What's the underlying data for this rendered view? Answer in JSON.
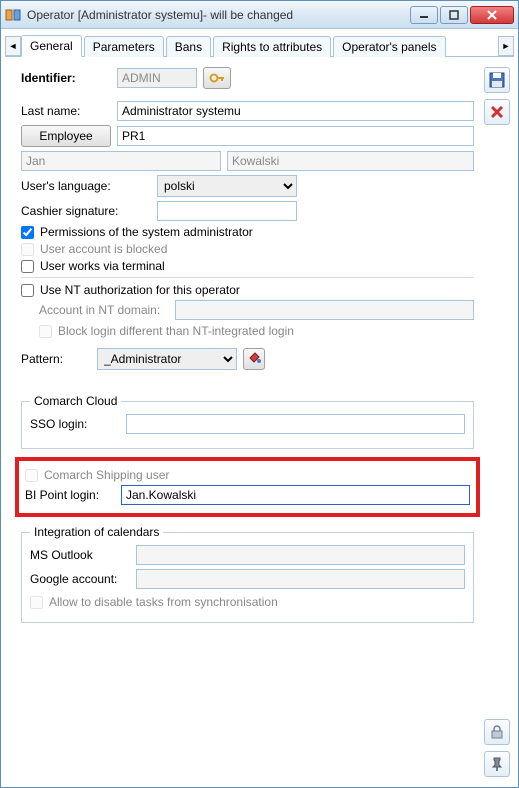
{
  "window": {
    "title": "Operator [Administrator systemu]- will be changed"
  },
  "tabs": {
    "general": "General",
    "parameters": "Parameters",
    "bans": "Bans",
    "rights": "Rights to attributes",
    "panels": "Operator's panels"
  },
  "identifier": {
    "label": "Identifier:",
    "value": "ADMIN"
  },
  "lastname": {
    "label": "Last name:",
    "value": "Administrator systemu"
  },
  "employee": {
    "button": "Employee",
    "value": "PR1"
  },
  "first_name": "Jan",
  "surname": "Kowalski",
  "language": {
    "label": "User's language:",
    "value": "polski"
  },
  "cashier": {
    "label": "Cashier signature:",
    "value": ""
  },
  "checkboxes": {
    "perms_admin": "Permissions of the system administrator",
    "account_blocked": "User account is blocked",
    "via_terminal": "User works via terminal",
    "use_nt": "Use NT authorization for this operator",
    "nt_domain_label": "Account in NT domain:",
    "block_nt_login": "Block login different than NT-integrated login"
  },
  "pattern": {
    "label": "Pattern:",
    "value": "_Administrator"
  },
  "cloud": {
    "legend": "Comarch Cloud",
    "sso_label": "SSO login:",
    "sso_value": ""
  },
  "shipping": {
    "shipping_user": "Comarch Shipping user",
    "bi_label": "BI Point login:",
    "bi_value": "Jan.Kowalski"
  },
  "calendars": {
    "legend": "Integration of calendars",
    "outlook": "MS Outlook",
    "google": "Google account:",
    "allow_disable": "Allow to disable tasks from synchronisation"
  }
}
